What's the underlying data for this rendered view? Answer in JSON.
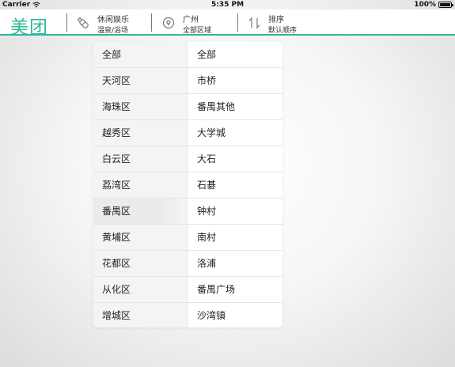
{
  "status_bar": {
    "carrier": "Carrier",
    "time": "5:35 PM",
    "battery": "100%"
  },
  "nav": {
    "logo": "美团",
    "filters": [
      {
        "icon": "bottle-icon",
        "line1": "休闲娱乐",
        "line2": "温泉/浴场"
      },
      {
        "icon": "location-pin-icon",
        "line1": "广州",
        "line2": "全部区域"
      },
      {
        "icon": "sort-arrows-icon",
        "line1": "排序",
        "line2": "默认顺序"
      }
    ]
  },
  "colors": {
    "brand": "#2fb79a"
  },
  "dropdown": {
    "districts": [
      "全部",
      "天河区",
      "海珠区",
      "越秀区",
      "白云区",
      "荔湾区",
      "番禺区",
      "黄埔区",
      "花都区",
      "从化区",
      "增城区"
    ],
    "selected_district": "番禺区",
    "subareas": [
      "全部",
      "市桥",
      "番禺其他",
      "大学城",
      "大石",
      "石碁",
      "钟村",
      "南村",
      "洛浦",
      "番禺广场",
      "沙湾镇"
    ]
  }
}
